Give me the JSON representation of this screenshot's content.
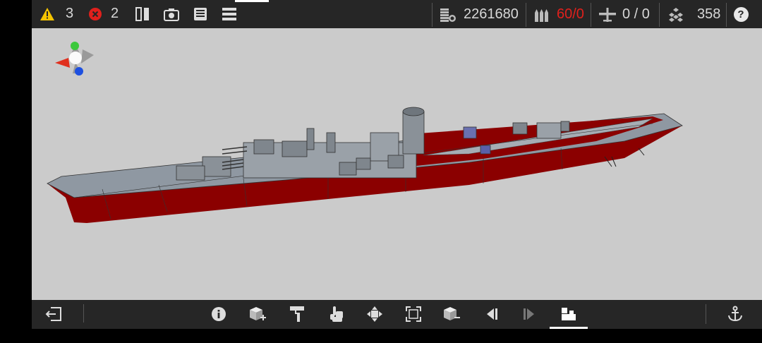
{
  "topbar": {
    "warnings": {
      "icon": "warning-icon",
      "count": "3",
      "color": "#f5c400"
    },
    "errors": {
      "icon": "error-icon",
      "count": "2",
      "color": "#e0201c"
    },
    "tools": [
      {
        "name": "mirror-view-icon"
      },
      {
        "name": "camera-icon"
      },
      {
        "name": "save-icon"
      },
      {
        "name": "menu-icon"
      }
    ],
    "stats": {
      "cost": {
        "icon": "coins-icon",
        "value": "2261680"
      },
      "ammo": {
        "icon": "ammo-icon",
        "value": "60/0",
        "color": "#e0201c"
      },
      "aircraft": {
        "icon": "aircraft-icon",
        "value": "0 / 0"
      },
      "parts": {
        "icon": "parts-icon",
        "value": "358"
      }
    },
    "help": {
      "icon": "help-icon",
      "label": "?"
    }
  },
  "viewport": {
    "background": "#cbcbcb",
    "ship": {
      "hull_color": "#8f98a2",
      "waterline_color": "#8b0000"
    },
    "gizmo": {
      "x_color": "#e0301e",
      "y_color": "#3cc83c",
      "z_color": "#1e50e0"
    }
  },
  "bottombar": {
    "exit": {
      "icon": "exit-icon"
    },
    "tools": [
      {
        "name": "info-icon"
      },
      {
        "name": "add-block-icon"
      },
      {
        "name": "paint-roller-icon"
      },
      {
        "name": "hand-pointer-icon"
      },
      {
        "name": "move-arrows-icon"
      },
      {
        "name": "resize-frame-icon"
      },
      {
        "name": "remove-block-icon"
      },
      {
        "name": "previous-icon"
      },
      {
        "name": "next-icon"
      },
      {
        "name": "builder-mode-icon",
        "active": true
      }
    ],
    "anchor": {
      "icon": "anchor-icon"
    }
  }
}
